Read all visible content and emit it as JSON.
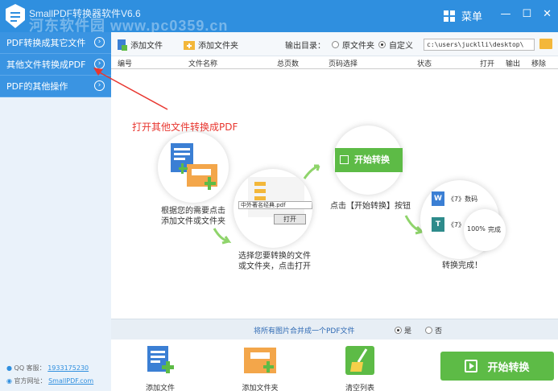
{
  "app": {
    "title": "SmallPDF转换器软件V6.6",
    "watermark": "河东软件园 www.pc0359.cn",
    "menu_label": "菜单",
    "win_controls": [
      "—",
      "☐",
      "✕"
    ]
  },
  "sidebar": {
    "items": [
      {
        "label": "PDF转换成其它文件"
      },
      {
        "label": "其他文件转换成PDF"
      },
      {
        "label": "PDF的其他操作"
      }
    ],
    "qq_label": "QQ 客服：",
    "qq_value": "1933175230",
    "site_label": "官方网址：",
    "site_value": "SmallPDF.com"
  },
  "toolbar": {
    "add_file": "添加文件",
    "add_folder": "添加文件夹",
    "output_dir_label": "输出目录：",
    "option_original": "原文件夹",
    "option_custom": "自定义",
    "output_path": "c:\\users\\jucklli\\desktop\\"
  },
  "table": {
    "columns": [
      "编号",
      "文件名称",
      "总页数",
      "页码选择",
      "状态",
      "打开",
      "输出",
      "移除"
    ]
  },
  "guide": {
    "annotation": "打开其他文件转换成PDF",
    "step1": "根据您的需要点击\n添加文件或文件夹",
    "step2": "选择您要转换的文件\n或文件夹，点击打开",
    "step3": "点击【开始转换】按钮",
    "step4": "转换完成！",
    "dialog_file": "中外著名经典.pdf",
    "dialog_open": "打开",
    "start_in_circle": "开始转换",
    "result_word": "《7》数码",
    "result_ppt": "《7》",
    "result_percent": "100%",
    "result_done": "完成"
  },
  "merge": {
    "text": "将所有图片合并成一个PDF文件",
    "yes": "是",
    "no": "否"
  },
  "bottom": {
    "add_file": "添加文件",
    "add_folder": "添加文件夹",
    "clear_list": "清空列表",
    "start": "开始转换"
  }
}
